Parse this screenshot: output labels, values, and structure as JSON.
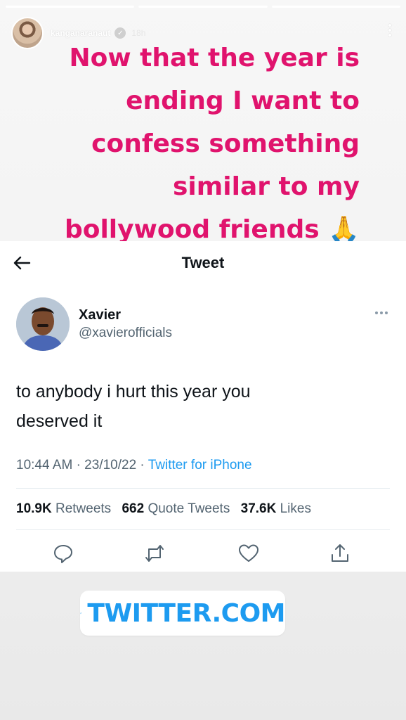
{
  "story": {
    "username": "kanganaranaut",
    "time": "18h",
    "progress_segments": 3,
    "caption_lines": [
      "Now that the year is",
      "ending I want to",
      "confess something",
      "similar to my",
      "bollywood friends 🙏"
    ],
    "caption_color": "#e0136d"
  },
  "tweet": {
    "topbar_title": "Tweet",
    "author_name": "Xavier",
    "author_handle": "@xavierofficials",
    "text_line1": "to anybody i hurt this year you",
    "text_line2": "deserved it",
    "time": "10:44 AM",
    "date": "23/10/22",
    "source": "Twitter for iPhone",
    "retweets_count": "10.9K",
    "retweets_label": "Retweets",
    "quotes_count": "662",
    "quotes_label": "Quote Tweets",
    "likes_count": "37.6K",
    "likes_label": "Likes",
    "accent_color": "#1d9bf0"
  },
  "link_sticker": {
    "label": "TWITTER.COM"
  },
  "icons": {
    "back": "back-arrow-icon",
    "reply": "reply-icon",
    "retweet": "retweet-icon",
    "like": "heart-icon",
    "share": "share-icon",
    "link": "link-icon"
  }
}
